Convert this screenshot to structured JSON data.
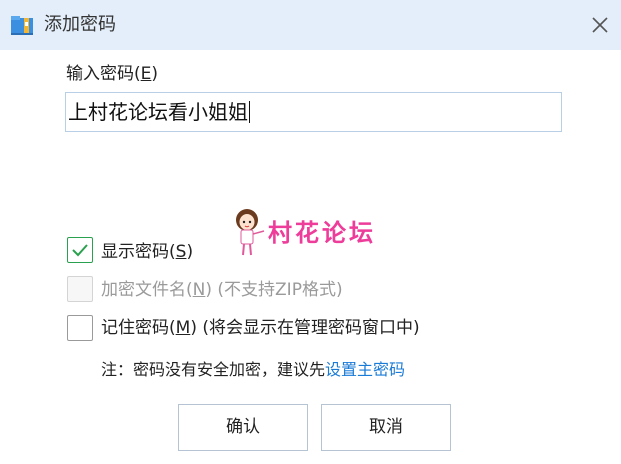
{
  "window": {
    "title": "添加密码",
    "icon": "archive-icon",
    "close_icon": "close-icon"
  },
  "password": {
    "label_prefix": "输入密码(",
    "label_key": "E",
    "label_suffix": ")",
    "value": "上村花论坛看小姐姐"
  },
  "watermark": {
    "text": "村花论坛",
    "color": "#ee3c9a"
  },
  "options": [
    {
      "checked": true,
      "enabled": true,
      "label_prefix": "显示密码(",
      "key": "S",
      "label_suffix": ")",
      "note": ""
    },
    {
      "checked": false,
      "enabled": false,
      "label_prefix": "加密文件名(",
      "key": "N",
      "label_suffix": ")",
      "note": " (不支持ZIP格式)"
    },
    {
      "checked": false,
      "enabled": true,
      "label_prefix": "记住密码(",
      "key": "M",
      "label_suffix": ")",
      "note": " (将会显示在管理密码窗口中)"
    }
  ],
  "note": {
    "text": "注：密码没有安全加密，建议先",
    "link": "设置主密码"
  },
  "buttons": {
    "ok": "确认",
    "cancel": "取消"
  },
  "colors": {
    "titlebar_bg": "#e3eefa",
    "check_green": "#2aa14e",
    "link_blue": "#1a7bd6"
  }
}
